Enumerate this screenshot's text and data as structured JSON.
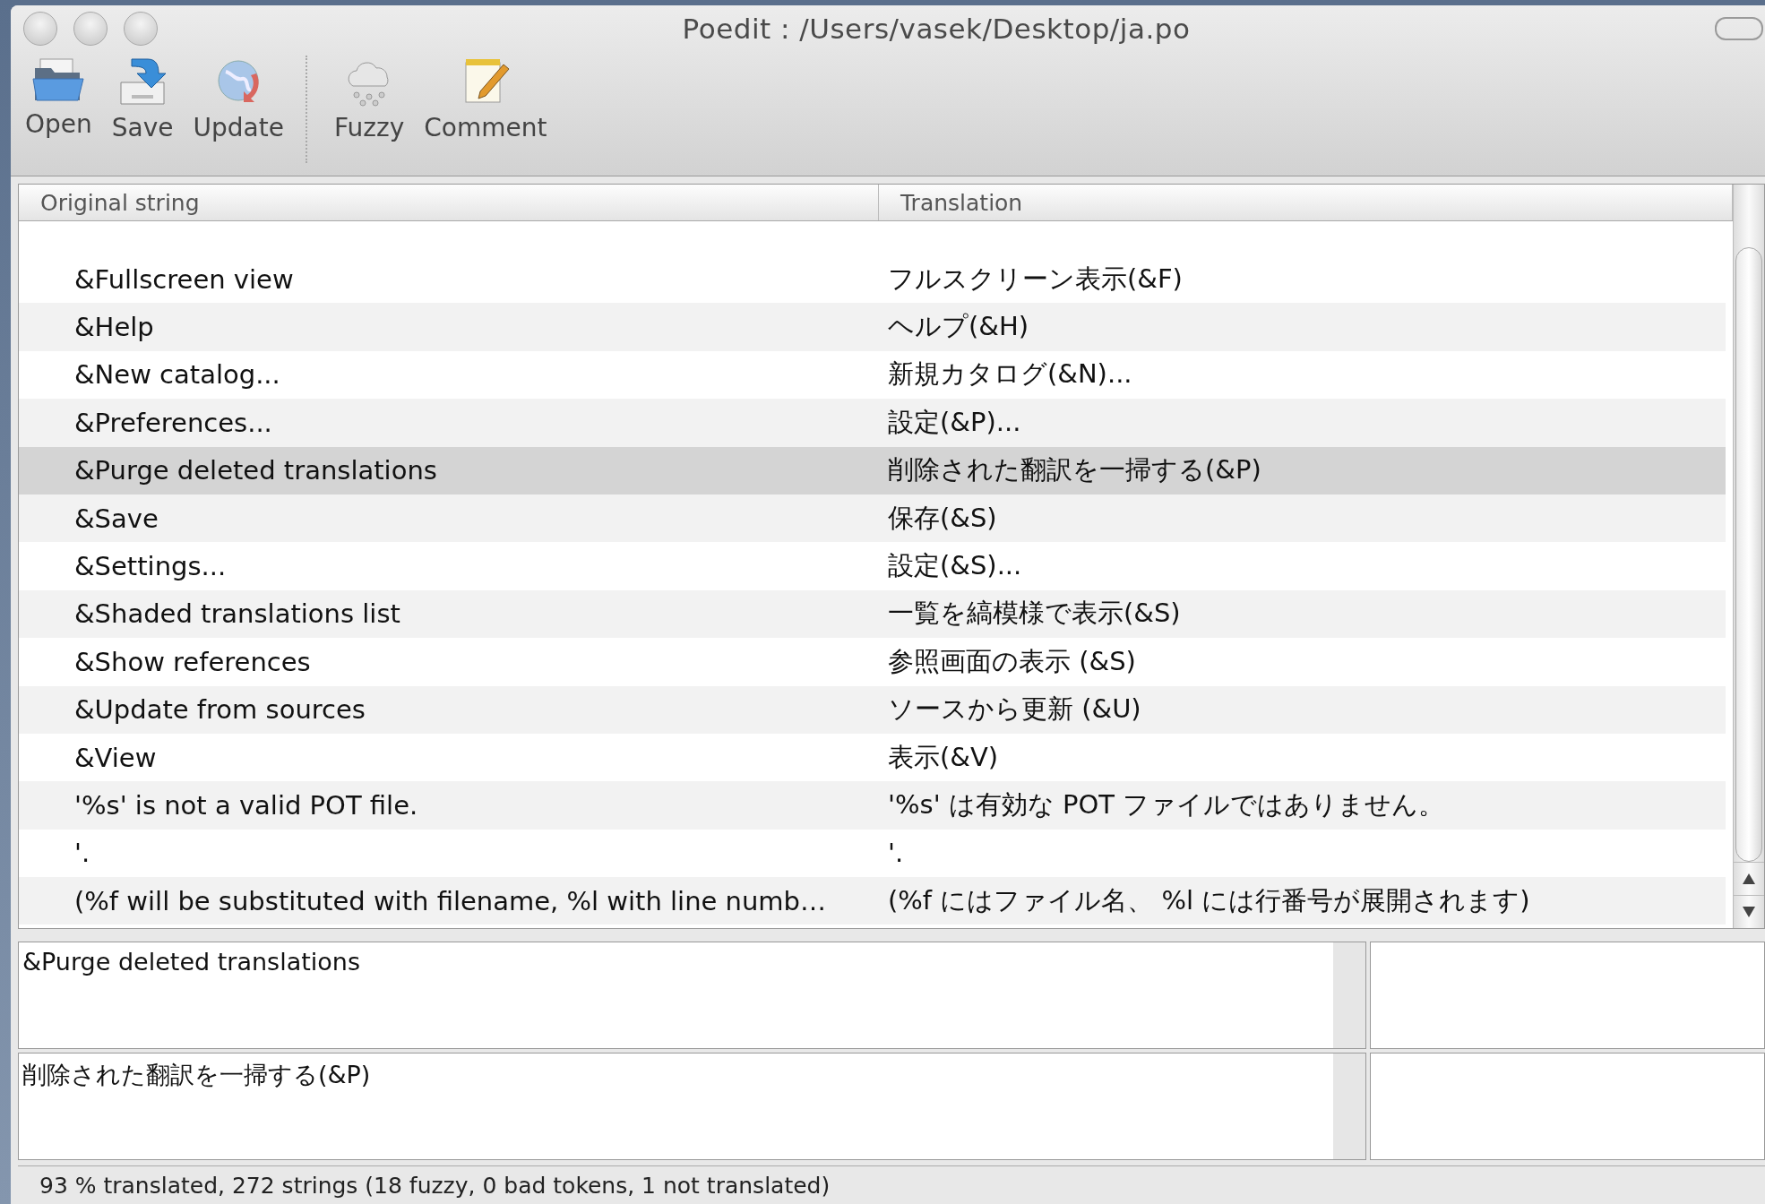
{
  "window": {
    "title": "Poedit : /Users/vasek/Desktop/ja.po"
  },
  "toolbar": {
    "groups": [
      {
        "items": [
          {
            "label": "Open",
            "kind": "open"
          },
          {
            "label": "Save",
            "kind": "save"
          },
          {
            "label": "Update",
            "kind": "update"
          }
        ]
      },
      {
        "items": [
          {
            "label": "Fuzzy",
            "kind": "fuzzy"
          },
          {
            "label": "Comment",
            "kind": "comment"
          }
        ]
      }
    ]
  },
  "table": {
    "columns": [
      "Original string",
      "Translation"
    ],
    "rows": [
      {
        "original": "&Fullscreen view",
        "translation": "フルスクリーン表示(&F)",
        "selected": false
      },
      {
        "original": "&Help",
        "translation": "ヘルプ(&H)",
        "selected": false
      },
      {
        "original": "&New catalog...",
        "translation": "新規カタログ(&N)...",
        "selected": false
      },
      {
        "original": "&Preferences...",
        "translation": "設定(&P)...",
        "selected": false
      },
      {
        "original": "&Purge deleted translations",
        "translation": "削除された翻訳を一掃する(&P)",
        "selected": true
      },
      {
        "original": "&Save",
        "translation": "保存(&S)",
        "selected": false
      },
      {
        "original": "&Settings...",
        "translation": "設定(&S)...",
        "selected": false
      },
      {
        "original": "&Shaded translations list",
        "translation": "一覧を縞模様で表示(&S)",
        "selected": false
      },
      {
        "original": "&Show references",
        "translation": "参照画面の表示 (&S)",
        "selected": false
      },
      {
        "original": "&Update from sources",
        "translation": "ソースから更新 (&U)",
        "selected": false
      },
      {
        "original": "&View",
        "translation": "表示(&V)",
        "selected": false
      },
      {
        "original": "'%s' is not a valid POT file.",
        "translation": "'%s' は有効な POT ファイルではありません。",
        "selected": false
      },
      {
        "original": "'.",
        "translation": "'.",
        "selected": false
      },
      {
        "original": "(%f will be substituted with filename, %l with line numb…",
        "translation": "(%f にはファイル名、 %l には行番号が展開されます)",
        "selected": false
      }
    ]
  },
  "editor": {
    "original": "&Purge deleted translations",
    "translation": "削除された翻訳を一掃する(&P)"
  },
  "status_bar": "93 % translated, 272 strings (18 fuzzy, 0 bad tokens, 1 not translated)"
}
